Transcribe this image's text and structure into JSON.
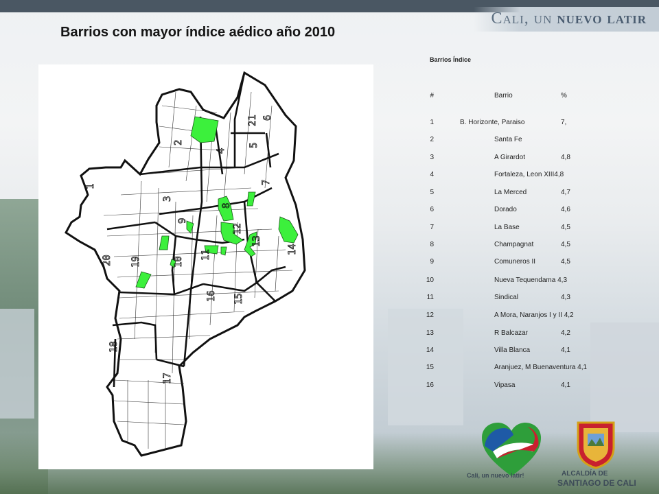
{
  "header": {
    "brand_prefix": "Cali, un ",
    "brand_strong": "nuevo latir"
  },
  "title": "Barrios con mayor índice aédico año 2010",
  "table": {
    "caption": "Barrios Índice",
    "columns": [
      "#",
      "Barrio",
      "%"
    ],
    "rows": [
      {
        "num": "1",
        "name": "B. Horizonte, Paraiso",
        "pct": "7,"
      },
      {
        "num": "2",
        "name": "Santa Fe",
        "pct": ""
      },
      {
        "num": "3",
        "name": "A Girardot",
        "pct": "4,8"
      },
      {
        "num": "4",
        "name": "Fortaleza, Leon XIII4,8",
        "pct": ""
      },
      {
        "num": "5",
        "name": "La Merced",
        "pct": "4,7"
      },
      {
        "num": "6",
        "name": "Dorado",
        "pct": "4,6"
      },
      {
        "num": "7",
        "name": "La Base",
        "pct": "4,5"
      },
      {
        "num": "8",
        "name": "Champagnat",
        "pct": "4,5"
      },
      {
        "num": "9",
        "name": "Comuneros II",
        "pct": "4,5"
      },
      {
        "num": "10",
        "name": "Nueva Tequendama 4,3",
        "pct": ""
      },
      {
        "num": "11",
        "name": "Sindical",
        "pct": "4,3"
      },
      {
        "num": "12",
        "name": "A Mora, Naranjos I y II 4,2",
        "pct": ""
      },
      {
        "num": "13",
        "name": "R Balcazar",
        "pct": "4,2"
      },
      {
        "num": "14",
        "name": "Villa Blanca",
        "pct": "4,1"
      },
      {
        "num": "15",
        "name": "Aranjuez, M Buenaventura 4,1",
        "pct": ""
      },
      {
        "num": "16",
        "name": "Vipasa",
        "pct": "4,1"
      }
    ]
  },
  "map": {
    "comuna_labels": [
      "1",
      "2",
      "3",
      "4",
      "5",
      "6",
      "7",
      "8",
      "9",
      "10",
      "11",
      "12",
      "13",
      "14",
      "15",
      "16",
      "17",
      "18",
      "19",
      "20",
      "21"
    ]
  },
  "logos": {
    "heart_caption": "Cali, un nuevo latir!",
    "seal_caption_1": "ALCALDÍA DE",
    "seal_caption_2": "SANTIAGO DE CALI"
  },
  "colors": {
    "highlight": "#3cf03c",
    "title": "#141414",
    "brand": "#5c6e80"
  }
}
